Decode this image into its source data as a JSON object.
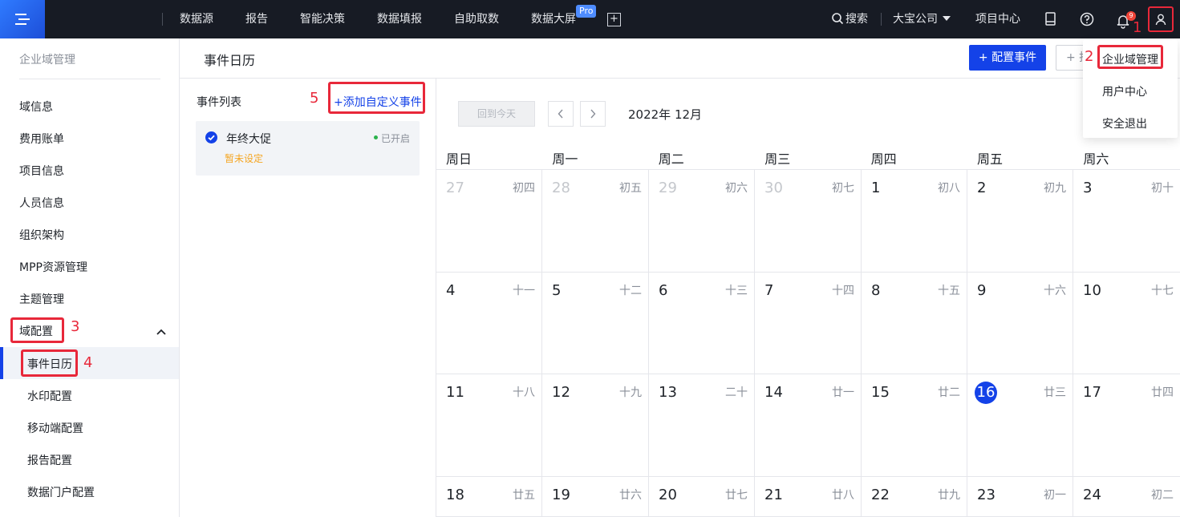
{
  "topbar": {
    "nav": [
      "数据源",
      "报告",
      "智能决策",
      "数据填报",
      "自助取数",
      "数据大屏"
    ],
    "pro_badge": "Pro",
    "search_label": "搜索",
    "company": "大宝公司",
    "project_center": "项目中心",
    "notification_count": "9"
  },
  "annotations": [
    "1",
    "2",
    "3",
    "4",
    "5"
  ],
  "dropdown": {
    "items": [
      "企业域管理",
      "用户中心",
      "安全退出"
    ]
  },
  "sidebar": {
    "title": "企业域管理",
    "items": [
      "域信息",
      "费用账单",
      "项目信息",
      "人员信息",
      "组织架构",
      "MPP资源管理",
      "主题管理",
      "域配置"
    ],
    "sub_items": [
      "事件日历",
      "水印配置",
      "移动端配置",
      "报告配置",
      "数据门户配置"
    ]
  },
  "header": {
    "title": "事件日历",
    "config_button": "+ 配置事件",
    "second_button": "+ 批"
  },
  "event_list": {
    "title": "事件列表",
    "add_custom": "+添加自定义事件",
    "events": [
      {
        "name": "年终大促",
        "status": "已开启",
        "subtitle": "暂未设定"
      }
    ]
  },
  "calendar": {
    "today_button": "回到今天",
    "month_label": "2022年 12月",
    "weekdays": [
      "周日",
      "周一",
      "周二",
      "周三",
      "周四",
      "周五",
      "周六"
    ],
    "today": 16,
    "weeks": [
      [
        {
          "d": "27",
          "l": "初四",
          "m": true
        },
        {
          "d": "28",
          "l": "初五",
          "m": true
        },
        {
          "d": "29",
          "l": "初六",
          "m": true
        },
        {
          "d": "30",
          "l": "初七",
          "m": true
        },
        {
          "d": "1",
          "l": "初八"
        },
        {
          "d": "2",
          "l": "初九"
        },
        {
          "d": "3",
          "l": "初十"
        }
      ],
      [
        {
          "d": "4",
          "l": "十一"
        },
        {
          "d": "5",
          "l": "十二"
        },
        {
          "d": "6",
          "l": "十三"
        },
        {
          "d": "7",
          "l": "十四"
        },
        {
          "d": "8",
          "l": "十五"
        },
        {
          "d": "9",
          "l": "十六"
        },
        {
          "d": "10",
          "l": "十七"
        }
      ],
      [
        {
          "d": "11",
          "l": "十八"
        },
        {
          "d": "12",
          "l": "十九"
        },
        {
          "d": "13",
          "l": "二十"
        },
        {
          "d": "14",
          "l": "廿一"
        },
        {
          "d": "15",
          "l": "廿二"
        },
        {
          "d": "16",
          "l": "廿三"
        },
        {
          "d": "17",
          "l": "廿四"
        }
      ],
      [
        {
          "d": "18",
          "l": "廿五"
        },
        {
          "d": "19",
          "l": "廿六"
        },
        {
          "d": "20",
          "l": "廿七"
        },
        {
          "d": "21",
          "l": "廿八"
        },
        {
          "d": "22",
          "l": "廿九"
        },
        {
          "d": "23",
          "l": "初一"
        },
        {
          "d": "24",
          "l": "初二"
        }
      ]
    ]
  },
  "colors": {
    "primary": "#1442e8",
    "annotation_red": "#e8283a",
    "topbar_bg": "#171b24"
  }
}
